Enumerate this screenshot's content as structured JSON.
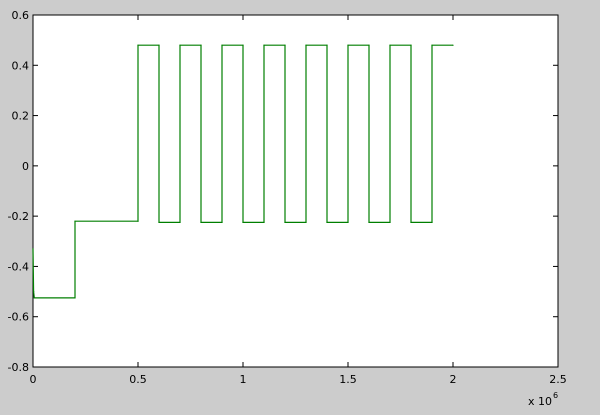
{
  "chart_data": {
    "type": "line",
    "title": "",
    "xlabel": "",
    "ylabel": "",
    "x_exponent_label": "x 10",
    "x_exponent": "6",
    "xlim": [
      0,
      2.5
    ],
    "ylim": [
      -0.8,
      0.6
    ],
    "x_ticks": [
      0,
      0.5,
      1,
      1.5,
      2,
      2.5
    ],
    "x_tick_labels": [
      "0",
      "0.5",
      "1",
      "1.5",
      "2",
      "2.5"
    ],
    "y_ticks": [
      -0.8,
      -0.6,
      -0.4,
      -0.2,
      0,
      0.2,
      0.4,
      0.6
    ],
    "y_tick_labels": [
      "-0.8",
      "-0.6",
      "-0.4",
      "-0.2",
      "0",
      "0.2",
      "0.4",
      "0.6"
    ],
    "grid": false,
    "legend": "none",
    "line_color": "#007f00",
    "background": "#cccccc",
    "axes_background": "#ffffff",
    "series": [
      {
        "x": [
          0,
          0.003,
          0.006,
          0.2,
          0.2,
          0.5,
          0.5,
          0.6,
          0.6,
          0.7,
          0.7,
          0.8,
          0.8,
          0.9,
          0.9,
          1.0,
          1.0,
          1.1,
          1.1,
          1.2,
          1.2,
          1.3,
          1.3,
          1.4,
          1.4,
          1.5,
          1.5,
          1.6,
          1.6,
          1.7,
          1.7,
          1.8,
          1.8,
          1.9,
          1.9,
          2.0
        ],
        "y": [
          -0.33,
          -0.5,
          -0.525,
          -0.525,
          -0.22,
          -0.22,
          0.48,
          0.48,
          -0.225,
          -0.225,
          0.48,
          0.48,
          -0.225,
          -0.225,
          0.48,
          0.48,
          -0.225,
          -0.225,
          0.48,
          0.48,
          -0.225,
          -0.225,
          0.48,
          0.48,
          -0.225,
          -0.225,
          0.48,
          0.48,
          -0.225,
          -0.225,
          0.48,
          0.48,
          -0.225,
          -0.225,
          0.48,
          0.48
        ]
      }
    ]
  }
}
